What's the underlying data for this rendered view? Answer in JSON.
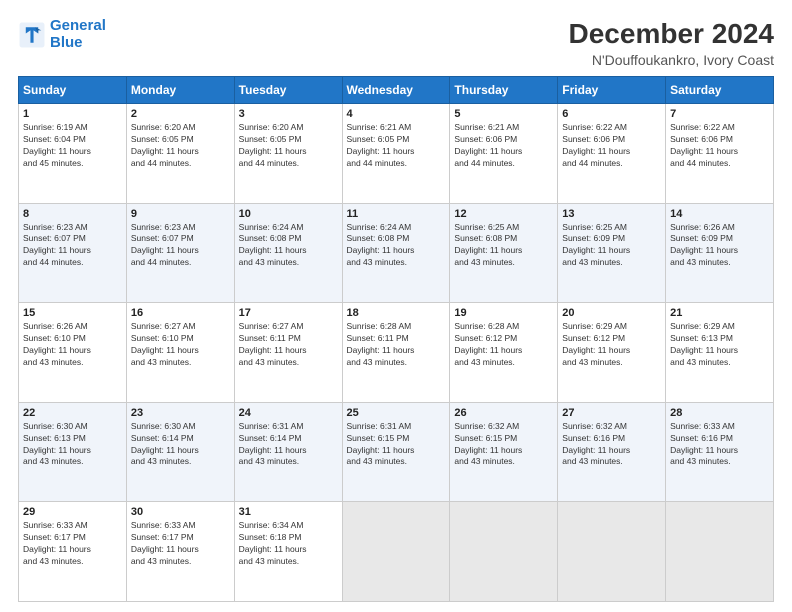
{
  "header": {
    "logo_general": "General",
    "logo_blue": "Blue",
    "main_title": "December 2024",
    "subtitle": "N'Douffoukankro, Ivory Coast"
  },
  "calendar": {
    "days_of_week": [
      "Sunday",
      "Monday",
      "Tuesday",
      "Wednesday",
      "Thursday",
      "Friday",
      "Saturday"
    ],
    "weeks": [
      [
        {
          "day": "1",
          "info": "Sunrise: 6:19 AM\nSunset: 6:04 PM\nDaylight: 11 hours\nand 45 minutes."
        },
        {
          "day": "2",
          "info": "Sunrise: 6:20 AM\nSunset: 6:05 PM\nDaylight: 11 hours\nand 44 minutes."
        },
        {
          "day": "3",
          "info": "Sunrise: 6:20 AM\nSunset: 6:05 PM\nDaylight: 11 hours\nand 44 minutes."
        },
        {
          "day": "4",
          "info": "Sunrise: 6:21 AM\nSunset: 6:05 PM\nDaylight: 11 hours\nand 44 minutes."
        },
        {
          "day": "5",
          "info": "Sunrise: 6:21 AM\nSunset: 6:06 PM\nDaylight: 11 hours\nand 44 minutes."
        },
        {
          "day": "6",
          "info": "Sunrise: 6:22 AM\nSunset: 6:06 PM\nDaylight: 11 hours\nand 44 minutes."
        },
        {
          "day": "7",
          "info": "Sunrise: 6:22 AM\nSunset: 6:06 PM\nDaylight: 11 hours\nand 44 minutes."
        }
      ],
      [
        {
          "day": "8",
          "info": "Sunrise: 6:23 AM\nSunset: 6:07 PM\nDaylight: 11 hours\nand 44 minutes."
        },
        {
          "day": "9",
          "info": "Sunrise: 6:23 AM\nSunset: 6:07 PM\nDaylight: 11 hours\nand 44 minutes."
        },
        {
          "day": "10",
          "info": "Sunrise: 6:24 AM\nSunset: 6:08 PM\nDaylight: 11 hours\nand 43 minutes."
        },
        {
          "day": "11",
          "info": "Sunrise: 6:24 AM\nSunset: 6:08 PM\nDaylight: 11 hours\nand 43 minutes."
        },
        {
          "day": "12",
          "info": "Sunrise: 6:25 AM\nSunset: 6:08 PM\nDaylight: 11 hours\nand 43 minutes."
        },
        {
          "day": "13",
          "info": "Sunrise: 6:25 AM\nSunset: 6:09 PM\nDaylight: 11 hours\nand 43 minutes."
        },
        {
          "day": "14",
          "info": "Sunrise: 6:26 AM\nSunset: 6:09 PM\nDaylight: 11 hours\nand 43 minutes."
        }
      ],
      [
        {
          "day": "15",
          "info": "Sunrise: 6:26 AM\nSunset: 6:10 PM\nDaylight: 11 hours\nand 43 minutes."
        },
        {
          "day": "16",
          "info": "Sunrise: 6:27 AM\nSunset: 6:10 PM\nDaylight: 11 hours\nand 43 minutes."
        },
        {
          "day": "17",
          "info": "Sunrise: 6:27 AM\nSunset: 6:11 PM\nDaylight: 11 hours\nand 43 minutes."
        },
        {
          "day": "18",
          "info": "Sunrise: 6:28 AM\nSunset: 6:11 PM\nDaylight: 11 hours\nand 43 minutes."
        },
        {
          "day": "19",
          "info": "Sunrise: 6:28 AM\nSunset: 6:12 PM\nDaylight: 11 hours\nand 43 minutes."
        },
        {
          "day": "20",
          "info": "Sunrise: 6:29 AM\nSunset: 6:12 PM\nDaylight: 11 hours\nand 43 minutes."
        },
        {
          "day": "21",
          "info": "Sunrise: 6:29 AM\nSunset: 6:13 PM\nDaylight: 11 hours\nand 43 minutes."
        }
      ],
      [
        {
          "day": "22",
          "info": "Sunrise: 6:30 AM\nSunset: 6:13 PM\nDaylight: 11 hours\nand 43 minutes."
        },
        {
          "day": "23",
          "info": "Sunrise: 6:30 AM\nSunset: 6:14 PM\nDaylight: 11 hours\nand 43 minutes."
        },
        {
          "day": "24",
          "info": "Sunrise: 6:31 AM\nSunset: 6:14 PM\nDaylight: 11 hours\nand 43 minutes."
        },
        {
          "day": "25",
          "info": "Sunrise: 6:31 AM\nSunset: 6:15 PM\nDaylight: 11 hours\nand 43 minutes."
        },
        {
          "day": "26",
          "info": "Sunrise: 6:32 AM\nSunset: 6:15 PM\nDaylight: 11 hours\nand 43 minutes."
        },
        {
          "day": "27",
          "info": "Sunrise: 6:32 AM\nSunset: 6:16 PM\nDaylight: 11 hours\nand 43 minutes."
        },
        {
          "day": "28",
          "info": "Sunrise: 6:33 AM\nSunset: 6:16 PM\nDaylight: 11 hours\nand 43 minutes."
        }
      ],
      [
        {
          "day": "29",
          "info": "Sunrise: 6:33 AM\nSunset: 6:17 PM\nDaylight: 11 hours\nand 43 minutes."
        },
        {
          "day": "30",
          "info": "Sunrise: 6:33 AM\nSunset: 6:17 PM\nDaylight: 11 hours\nand 43 minutes."
        },
        {
          "day": "31",
          "info": "Sunrise: 6:34 AM\nSunset: 6:18 PM\nDaylight: 11 hours\nand 43 minutes."
        },
        {
          "day": "",
          "info": ""
        },
        {
          "day": "",
          "info": ""
        },
        {
          "day": "",
          "info": ""
        },
        {
          "day": "",
          "info": ""
        }
      ]
    ]
  }
}
